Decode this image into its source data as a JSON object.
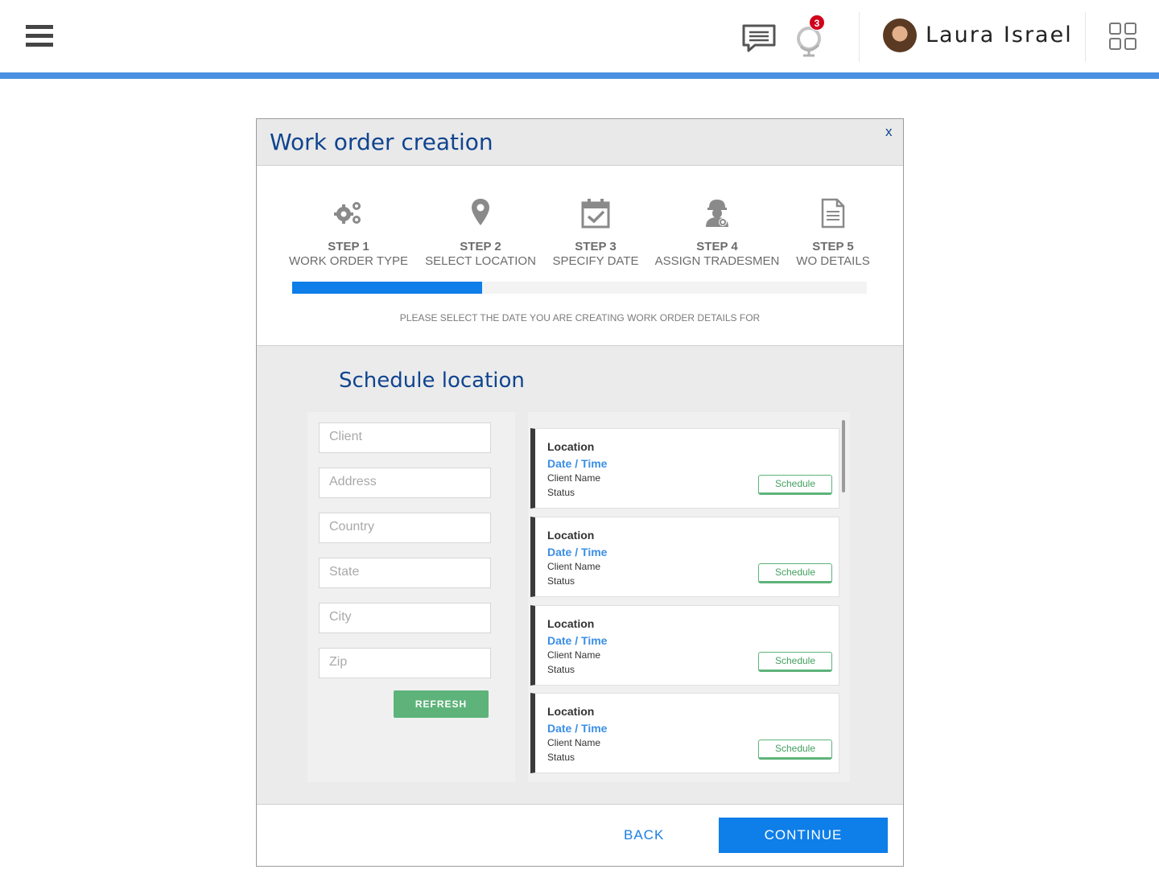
{
  "header": {
    "notification_count": "3",
    "user_name": "Laura Israel"
  },
  "modal": {
    "title": "Work order creation",
    "close_label": "x",
    "steps": [
      {
        "number": "STEP 1",
        "name": "WORK ORDER TYPE",
        "icon": "gears-icon"
      },
      {
        "number": "STEP 2",
        "name": "SELECT LOCATION",
        "icon": "map-pin-icon"
      },
      {
        "number": "STEP 3",
        "name": "SPECIFY DATE",
        "icon": "calendar-check-icon"
      },
      {
        "number": "STEP 4",
        "name": "ASSIGN TRADESMEN",
        "icon": "worker-icon"
      },
      {
        "number": "STEP 5",
        "name": "WO DETAILS",
        "icon": "document-icon"
      }
    ],
    "progress_fraction": 0.33,
    "instruction": "PLEASE SELECT THE DATE YOU ARE CREATING WORK ORDER DETAILS FOR",
    "section_title": "Schedule location",
    "filters": {
      "client_placeholder": "Client",
      "address_placeholder": "Address",
      "country_placeholder": "Country",
      "state_placeholder": "State",
      "city_placeholder": "City",
      "zip_placeholder": "Zip",
      "refresh_label": "REFRESH"
    },
    "locations": [
      {
        "location": "Location",
        "datetime": "Date / Time",
        "client": "Client Name",
        "status": "Status",
        "action": "Schedule"
      },
      {
        "location": "Location",
        "datetime": "Date / Time",
        "client": "Client Name",
        "status": "Status",
        "action": "Schedule"
      },
      {
        "location": "Location",
        "datetime": "Date / Time",
        "client": "Client Name",
        "status": "Status",
        "action": "Schedule"
      },
      {
        "location": "Location",
        "datetime": "Date / Time",
        "client": "Client Name",
        "status": "Status",
        "action": "Schedule"
      }
    ],
    "footer": {
      "back_label": "BACK",
      "continue_label": "CONTINUE"
    }
  },
  "colors": {
    "accent": "#0e7ee8",
    "title_blue": "#10448f",
    "success_green": "#5eb37a",
    "badge_red": "#d0021b"
  }
}
